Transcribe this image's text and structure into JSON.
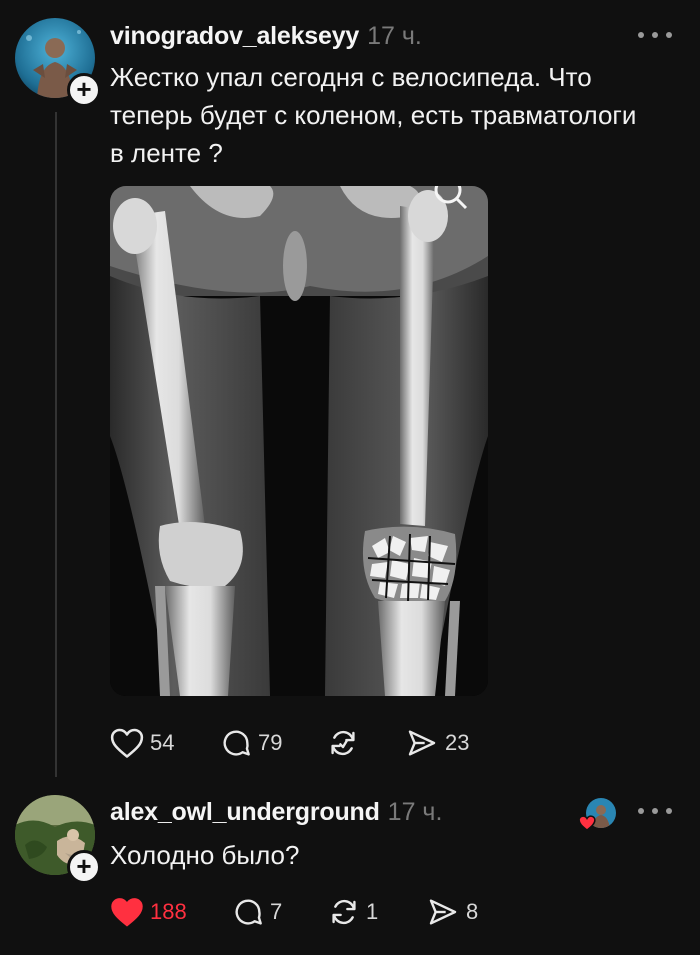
{
  "post": {
    "username": "vinogradov_alekseyy",
    "time": "17 ч.",
    "text_line1": "Жестко упал сегодня с велосипеда. Что",
    "text_line2": "теперь будет с коленом, есть травматологи",
    "text_line3": "в ленте ?",
    "likes": "54",
    "comments": "79",
    "reposts": "",
    "shares": "23"
  },
  "reply": {
    "username": "alex_owl_underground",
    "time": "17 ч.",
    "text": "Холодно было?",
    "likes": "188",
    "comments": "7",
    "reposts": "1",
    "shares": "8"
  },
  "colors": {
    "background": "#101010",
    "like_active": "#ff3040",
    "muted": "#7a7a7a"
  },
  "icons": [
    "heart-icon",
    "comment-icon",
    "repost-icon",
    "share-icon",
    "more-icon",
    "plus-icon",
    "zoom-icon"
  ]
}
